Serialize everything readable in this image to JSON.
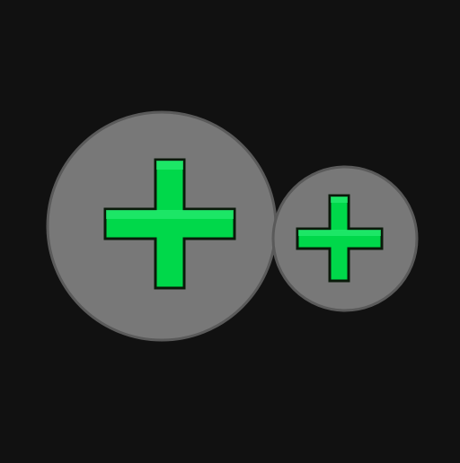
{
  "icon": {
    "name": "double-plus-icon",
    "colors": {
      "background": "#111111",
      "circle_fill": "#787878",
      "circle_stroke": "#5a5a5a",
      "plus_fill": "#00d84a",
      "plus_highlight": "#2ef07a",
      "plus_stroke": "#0a1a0a"
    }
  }
}
